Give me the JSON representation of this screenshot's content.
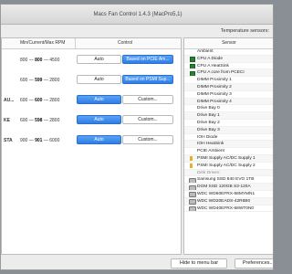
{
  "window": {
    "title": "Macs Fan Control 1.4.3 (MacPro5,1)"
  },
  "fans": {
    "header": {
      "rpm_col": "Min/Current/Max RPM",
      "control_col": "Control"
    },
    "rows": [
      {
        "name": "",
        "min": "800",
        "current": "800",
        "max": "4500",
        "auto_label": "Auto",
        "custom_label": "Based on PCIE Am...",
        "mode": "custom"
      },
      {
        "name": "",
        "min": "600",
        "current": "599",
        "max": "2800",
        "auto_label": "Auto",
        "custom_label": "Based on PSMI Sup...",
        "mode": "custom"
      },
      {
        "name": "AU...",
        "min": "600",
        "current": "600",
        "max": "2800",
        "auto_label": "Auto",
        "custom_label": "Custom...",
        "mode": "auto"
      },
      {
        "name": "KE",
        "min": "600",
        "current": "598",
        "max": "2800",
        "auto_label": "Auto",
        "custom_label": "Custom...",
        "mode": "auto"
      },
      {
        "name": "STA",
        "min": "900",
        "current": "901",
        "max": "6000",
        "auto_label": "Auto",
        "custom_label": "Custom...",
        "mode": "auto"
      }
    ]
  },
  "sensors": {
    "title": "Temperature sensors:",
    "header": "Sensor",
    "items": [
      {
        "label": "Ambient",
        "icon": "none"
      },
      {
        "label": "CPU A Diode",
        "icon": "chip-icon"
      },
      {
        "label": "CPU A HeatSink",
        "icon": "chip-icon"
      },
      {
        "label": "CPU A core from PCECI",
        "icon": "chip-icon"
      },
      {
        "label": "DIMM Proximity 1",
        "icon": "none"
      },
      {
        "label": "DIMM Proximity 2",
        "icon": "none"
      },
      {
        "label": "DIMM Proximity 3",
        "icon": "none"
      },
      {
        "label": "DIMM Proximity 4",
        "icon": "none"
      },
      {
        "label": "Drive Bay 0",
        "icon": "none"
      },
      {
        "label": "Drive Bay 1",
        "icon": "none"
      },
      {
        "label": "Drive Bay 2",
        "icon": "none"
      },
      {
        "label": "Drive Bay 3",
        "icon": "none"
      },
      {
        "label": "IOH Diode",
        "icon": "none"
      },
      {
        "label": "IOH HeatSink",
        "icon": "none"
      },
      {
        "label": "PCIE Ambient",
        "icon": "none"
      },
      {
        "label": "PSMI Supply AC/DC Supply 1",
        "icon": "psu-icon"
      },
      {
        "label": "PSMI Supply AC/DC Supply 2",
        "icon": "psu-icon"
      },
      {
        "label": "Disk Drives:",
        "icon": "header"
      },
      {
        "label": "Samsung SSD 840 EVO 1TB",
        "icon": "disk-icon"
      },
      {
        "label": "DGM SSD 120GB S3-120A",
        "icon": "disk-icon"
      },
      {
        "label": "WDC WD60EFRX-68MYMN1",
        "icon": "disk-icon"
      },
      {
        "label": "WDC WD20EADS-42R6B0",
        "icon": "disk-icon"
      },
      {
        "label": "WDC WD40EFRX-68WT0N0",
        "icon": "disk-icon"
      }
    ]
  },
  "footer": {
    "hide_label": "Hide to menu bar",
    "prefs_label": "Preferences..."
  },
  "colors": {
    "accent_blue": "#2f7ee6",
    "chip_green": "#2e7d32"
  }
}
